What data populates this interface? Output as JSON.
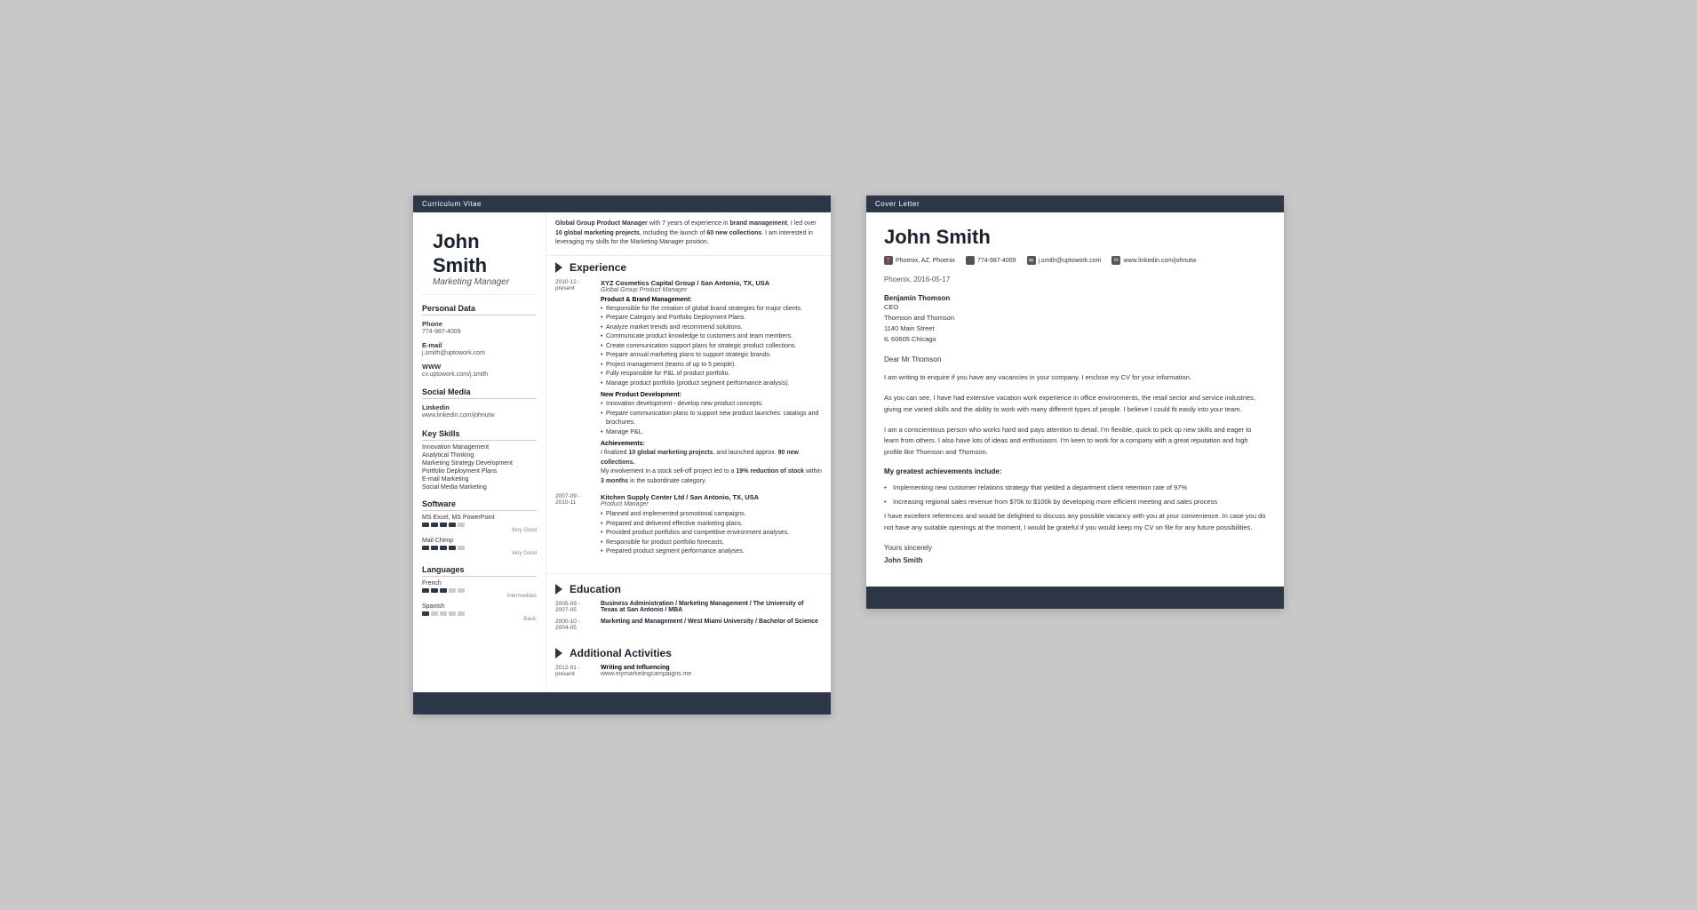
{
  "cv": {
    "header_bar": "Curriculum Vitae",
    "name": "John Smith",
    "title": "Marketing Manager",
    "intro": {
      "text_before1": "Global Group Product Manager",
      "text1": " with 7 years of experience in ",
      "bold1": "brand management",
      "text2": ", I led over ",
      "bold2": "10 global marketing projects",
      "text3": ", including the launch of ",
      "bold3": "60 new collections",
      "text4": ". I am interested in leveraging my skills for the Marketing Manager position."
    },
    "sidebar": {
      "personal_data_title": "Personal Data",
      "phone_label": "Phone",
      "phone_value": "774-987-4009",
      "email_label": "E-mail",
      "email_value": "j.smith@uptowork.com",
      "www_label": "WWW",
      "www_value": "cv.uptowork.com/j.smith",
      "social_media_title": "Social Media",
      "linkedin_label": "Linkedin",
      "linkedin_value": "www.linkedin.com/johnutw",
      "key_skills_title": "Key Skills",
      "skills": [
        "Innovation Management",
        "Analytical Thinking",
        "Marketing Strategy Development",
        "Portfolio Deployment Plans",
        "E-mail Marketing",
        "Social Media Marketing"
      ],
      "software_title": "Software",
      "software_items": [
        {
          "name": "MS Excel, MS PowerPoint",
          "level": 4,
          "max": 5,
          "label": "Very Good"
        },
        {
          "name": "Mail Chimp",
          "level": 4,
          "max": 5,
          "label": "Very Good"
        }
      ],
      "languages_title": "Languages",
      "language_items": [
        {
          "name": "French",
          "level": 3,
          "max": 5,
          "label": "Intermediate"
        },
        {
          "name": "Spanish",
          "level": 1,
          "max": 5,
          "label": "Basic"
        }
      ]
    },
    "experience": {
      "section_title": "Experience",
      "items": [
        {
          "date": "2010-12 - present",
          "company": "XYZ Cosmetics Capital Group / San Antonio, TX, USA",
          "job_title": "Global Group Product Manager",
          "subsections": [
            {
              "title": "Product & Brand Management:",
              "bullets": [
                "Responsible for the creation of global brand strategies for major clients.",
                "Prepare Category and Portfolio Deployment Plans.",
                "Analyze market trends and recommend solutions.",
                "Communicate product knowledge to customers and team members.",
                "Create communication support plans for strategic product collections.",
                "Prepare annual marketing plans to support strategic brands.",
                "Project management (teams of up to 5 people).",
                "Fully responsible for P&L of product portfolio.",
                "Manage product portfolio (product segment performance analysis)."
              ]
            },
            {
              "title": "New Product Development:",
              "bullets": [
                "Innovation development - develop new product concepts.",
                "Prepare communication plans to support new product launches: catalogs and brochures.",
                "Manage P&L."
              ]
            }
          ],
          "achievements_title": "Achievements:",
          "achievements": [
            "I finalized **10 global marketing projects**, and launched approx. **90 new collections.**",
            "My involvement in a stock sell-off project led to a **19% reduction of stock** within **3 months** in the subordinate category."
          ]
        },
        {
          "date": "2007-09 - 2010-11",
          "company": "Kitchen Supply Center Ltd / San Antonio, TX, USA",
          "job_title": "Product Manager",
          "bullets": [
            "Planned and implemented promotional campaigns.",
            "Prepared and delivered effective marketing plans.",
            "Provided product portfolios and competitive environment analyses.",
            "Responsible for product portfolio forecasts.",
            "Prepared product segment performance analyses."
          ]
        }
      ]
    },
    "education": {
      "section_title": "Education",
      "items": [
        {
          "date": "2005-09 - 2007-05",
          "degree": "Business Administration / Marketing Management / The University of Texas at San Antonio / MBA"
        },
        {
          "date": "2000-10 - 2004-05",
          "degree": "Marketing and Management / West Miami University / Bachelor of Science"
        }
      ]
    },
    "activities": {
      "section_title": "Additional Activities",
      "items": [
        {
          "date": "2012-01 - present",
          "title": "Writing and Influencing",
          "detail": "www.mymarketingcampaigns.me"
        }
      ]
    }
  },
  "cover_letter": {
    "header_bar": "Cover Letter",
    "name": "John Smith",
    "contact": {
      "location": "Phoenix, AZ, Phoenix",
      "phone": "774-987-4009",
      "email": "j.smith@uptowork.com",
      "linkedin": "www.linkedin.com/johnutw"
    },
    "date": "Phoenix, 2016-05-17",
    "recipient": {
      "name": "Benjamin Thomson",
      "role": "CEO",
      "company": "Thomson and Thomson",
      "address": "1140 Main Street",
      "city": "IL 60605 Chicago"
    },
    "salutation": "Dear Mr Thomson",
    "paragraphs": [
      "I am writing to enquire if you have any vacancies in your company. I enclose my CV for your information.",
      "As you can see, I have had extensive vacation work experience in office environments, the retail sector and service industries, giving me varied skills and the ability to work with many different types of people. I believe I could fit easily into your team.",
      "I am a conscientious person who works hard and pays attention to detail. I'm flexible, quick to pick up new skills and eager to learn from others. I also have lots of ideas and enthusiasm. I'm keen to work for a company with a great reputation and high profile like Thomson and Thomson."
    ],
    "achievements_title": "My greatest achievements include:",
    "achievements": [
      "Implementing new customer relations strategy that yielded a department client retention rate of 97%",
      "Increasing regional sales revenue from $70k to $100k by developing more efficient meeting and sales process"
    ],
    "closing_paragraph": "I have excellent references and would be delighted to discuss any possible vacancy with you at your convenience. In case you do not have any suitable openings at the moment, I would be grateful if you would keep my CV on file for any future possibilities.",
    "yours_sincerely": "Yours sincerely",
    "signature": "John Smith"
  }
}
